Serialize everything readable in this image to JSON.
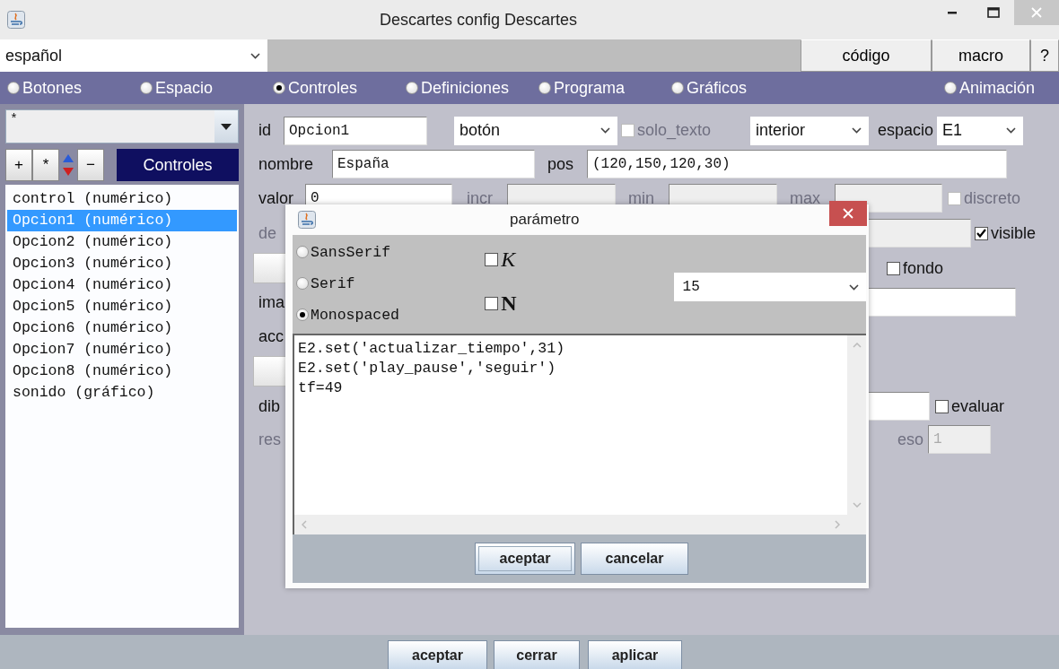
{
  "window": {
    "title": "Descartes config Descartes"
  },
  "toolbar": {
    "language": "español",
    "buttons": [
      "código",
      "macro",
      "?"
    ]
  },
  "sections": [
    {
      "label": "Botones",
      "selected": false
    },
    {
      "label": "Espacio",
      "selected": false
    },
    {
      "label": "Controles",
      "selected": true
    },
    {
      "label": "Definiciones",
      "selected": false
    },
    {
      "label": "Programa",
      "selected": false
    },
    {
      "label": "Gráficos",
      "selected": false
    },
    {
      "label": "Animación",
      "selected": false
    }
  ],
  "controls_panel": {
    "filter": "*",
    "buttons": [
      "+",
      "*",
      "−"
    ],
    "title": "Controles",
    "items": [
      {
        "label": "control (numérico)",
        "selected": false
      },
      {
        "label": "Opcion1 (numérico)",
        "selected": true
      },
      {
        "label": "Opcion2 (numérico)",
        "selected": false
      },
      {
        "label": "Opcion3 (numérico)",
        "selected": false
      },
      {
        "label": "Opcion4 (numérico)",
        "selected": false
      },
      {
        "label": "Opcion5 (numérico)",
        "selected": false
      },
      {
        "label": "Opcion6 (numérico)",
        "selected": false
      },
      {
        "label": "Opcion7 (numérico)",
        "selected": false
      },
      {
        "label": "Opcion8 (numérico)",
        "selected": false
      },
      {
        "label": "sonido (gráfico)",
        "selected": false
      }
    ]
  },
  "form": {
    "id_label": {
      "text": "id",
      "disabled": false
    },
    "id": "Opcion1",
    "type": "botón",
    "solo_texto": {
      "label": "solo_texto",
      "checked": false,
      "disabled": true
    },
    "region": "interior",
    "space_label": {
      "text": "espacio",
      "disabled": false
    },
    "space": "E1",
    "name_label": {
      "text": "nombre",
      "disabled": false
    },
    "name": "España",
    "pos_label": {
      "text": "pos",
      "disabled": false
    },
    "pos": "(120,150,120,30)",
    "value_label": {
      "text": "valor",
      "disabled": false
    },
    "value": "0",
    "incr_label": {
      "text": "incr",
      "disabled": true
    },
    "min_label": {
      "text": "min",
      "disabled": true
    },
    "max_label": {
      "text": "max",
      "disabled": true
    },
    "discreto": {
      "label": "discreto",
      "checked": false,
      "disabled": true
    },
    "dec_label": {
      "text": "de",
      "disabled": true
    },
    "visible": {
      "label": "visible",
      "checked": true,
      "disabled": false
    },
    "fondo": {
      "label": "fondo",
      "checked": false,
      "disabled": false
    },
    "image_label": {
      "text": "ima",
      "disabled": false
    },
    "action_label": {
      "text": "acc",
      "disabled": false
    },
    "draw_label": {
      "text": "dib",
      "disabled": false
    },
    "evaluar": {
      "label": "evaluar",
      "checked": false,
      "disabled": false
    },
    "res_label": {
      "text": "res",
      "disabled": true
    },
    "peso_label": {
      "text": "eso",
      "disabled": true
    },
    "peso": "1"
  },
  "dialog": {
    "title": "parámetro",
    "fonts": [
      {
        "label": "SansSerif",
        "selected": false
      },
      {
        "label": "Serif",
        "selected": false
      },
      {
        "label": "Monospaced",
        "selected": true
      }
    ],
    "italic": {
      "label": "K",
      "checked": false
    },
    "bold": {
      "label": "N",
      "checked": false
    },
    "size": "15",
    "code": [
      "E2.set('actualizar_tiempo',31)",
      "E2.set('play_pause','seguir')",
      "tf=49"
    ],
    "buttons": [
      "aceptar",
      "cancelar"
    ]
  },
  "footer": {
    "buttons": [
      "aceptar",
      "cerrar",
      "aplicar"
    ]
  }
}
